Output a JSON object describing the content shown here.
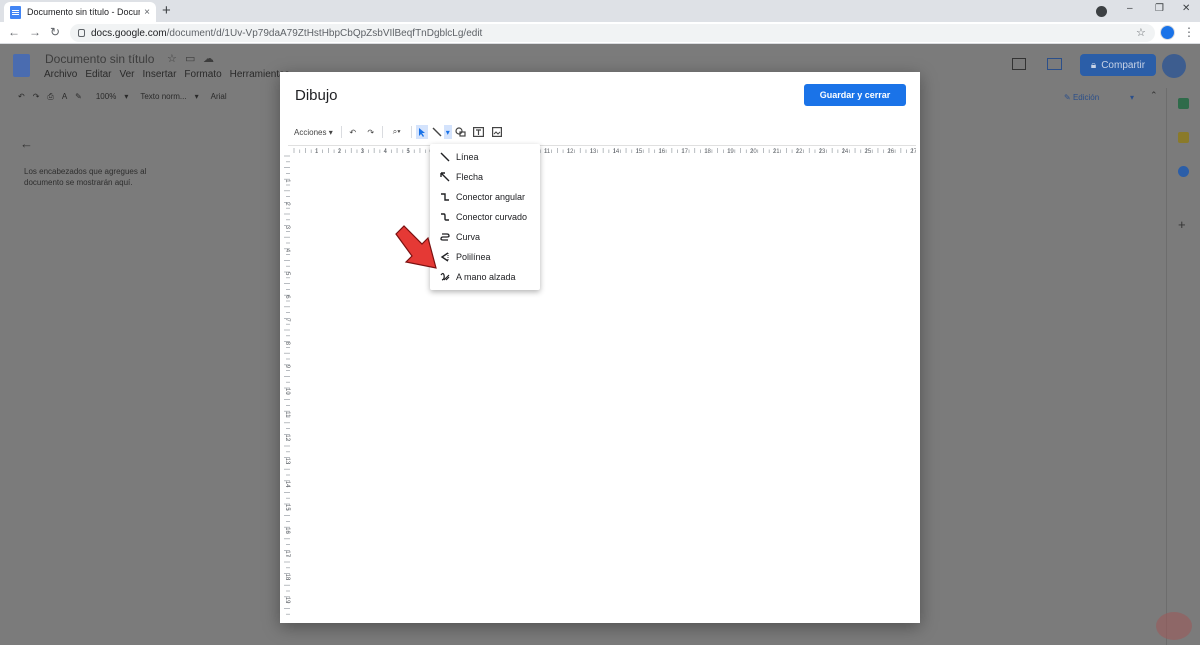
{
  "browser": {
    "tab_title": "Documento sin título - Docume",
    "tab_close": "×",
    "new_tab": "+",
    "url_host": "docs.google.com",
    "url_path": "/document/d/1Uv-Vp79daA79ZtHstHbpCbQpZsbVIlBeqfTnDgblcLg/edit"
  },
  "docs": {
    "title": "Documento sin título",
    "menu": [
      "Archivo",
      "Editar",
      "Ver",
      "Insertar",
      "Formato",
      "Herramientas"
    ],
    "toolbar": {
      "zoom": "100%",
      "style": "Texto norm...",
      "font": "Arial"
    },
    "outline_text": "Los encabezados que agregues al documento se mostrarán aquí.",
    "share_label": "Compartir",
    "edit_mode": "Edición"
  },
  "dialog": {
    "title": "Dibujo",
    "save_label": "Guardar y cerrar",
    "actions_label": "Acciones",
    "ruler_numbers": [
      "1",
      "2",
      "3",
      "4",
      "5",
      "6",
      "7",
      "8",
      "9",
      "10",
      "11",
      "12",
      "13",
      "14",
      "15",
      "16",
      "17",
      "18",
      "19",
      "20",
      "21",
      "22",
      "23",
      "24",
      "25",
      "26",
      "27"
    ],
    "vruler_numbers": [
      "1",
      "2",
      "3",
      "4",
      "5",
      "6",
      "7",
      "8",
      "9",
      "10",
      "11",
      "12",
      "13",
      "14",
      "15",
      "16",
      "17",
      "18",
      "19",
      "20"
    ]
  },
  "line_menu": {
    "items": [
      {
        "label": "Línea",
        "icon": "line-icon"
      },
      {
        "label": "Flecha",
        "icon": "arrow-icon"
      },
      {
        "label": "Conector angular",
        "icon": "elbow-connector-icon"
      },
      {
        "label": "Conector curvado",
        "icon": "curved-connector-icon"
      },
      {
        "label": "Curva",
        "icon": "curve-icon"
      },
      {
        "label": "Polilínea",
        "icon": "polyline-icon"
      },
      {
        "label": "A mano alzada",
        "icon": "scribble-icon"
      }
    ]
  },
  "colors": {
    "accent": "#1a73e8",
    "annotation_arrow": "#e53935"
  }
}
